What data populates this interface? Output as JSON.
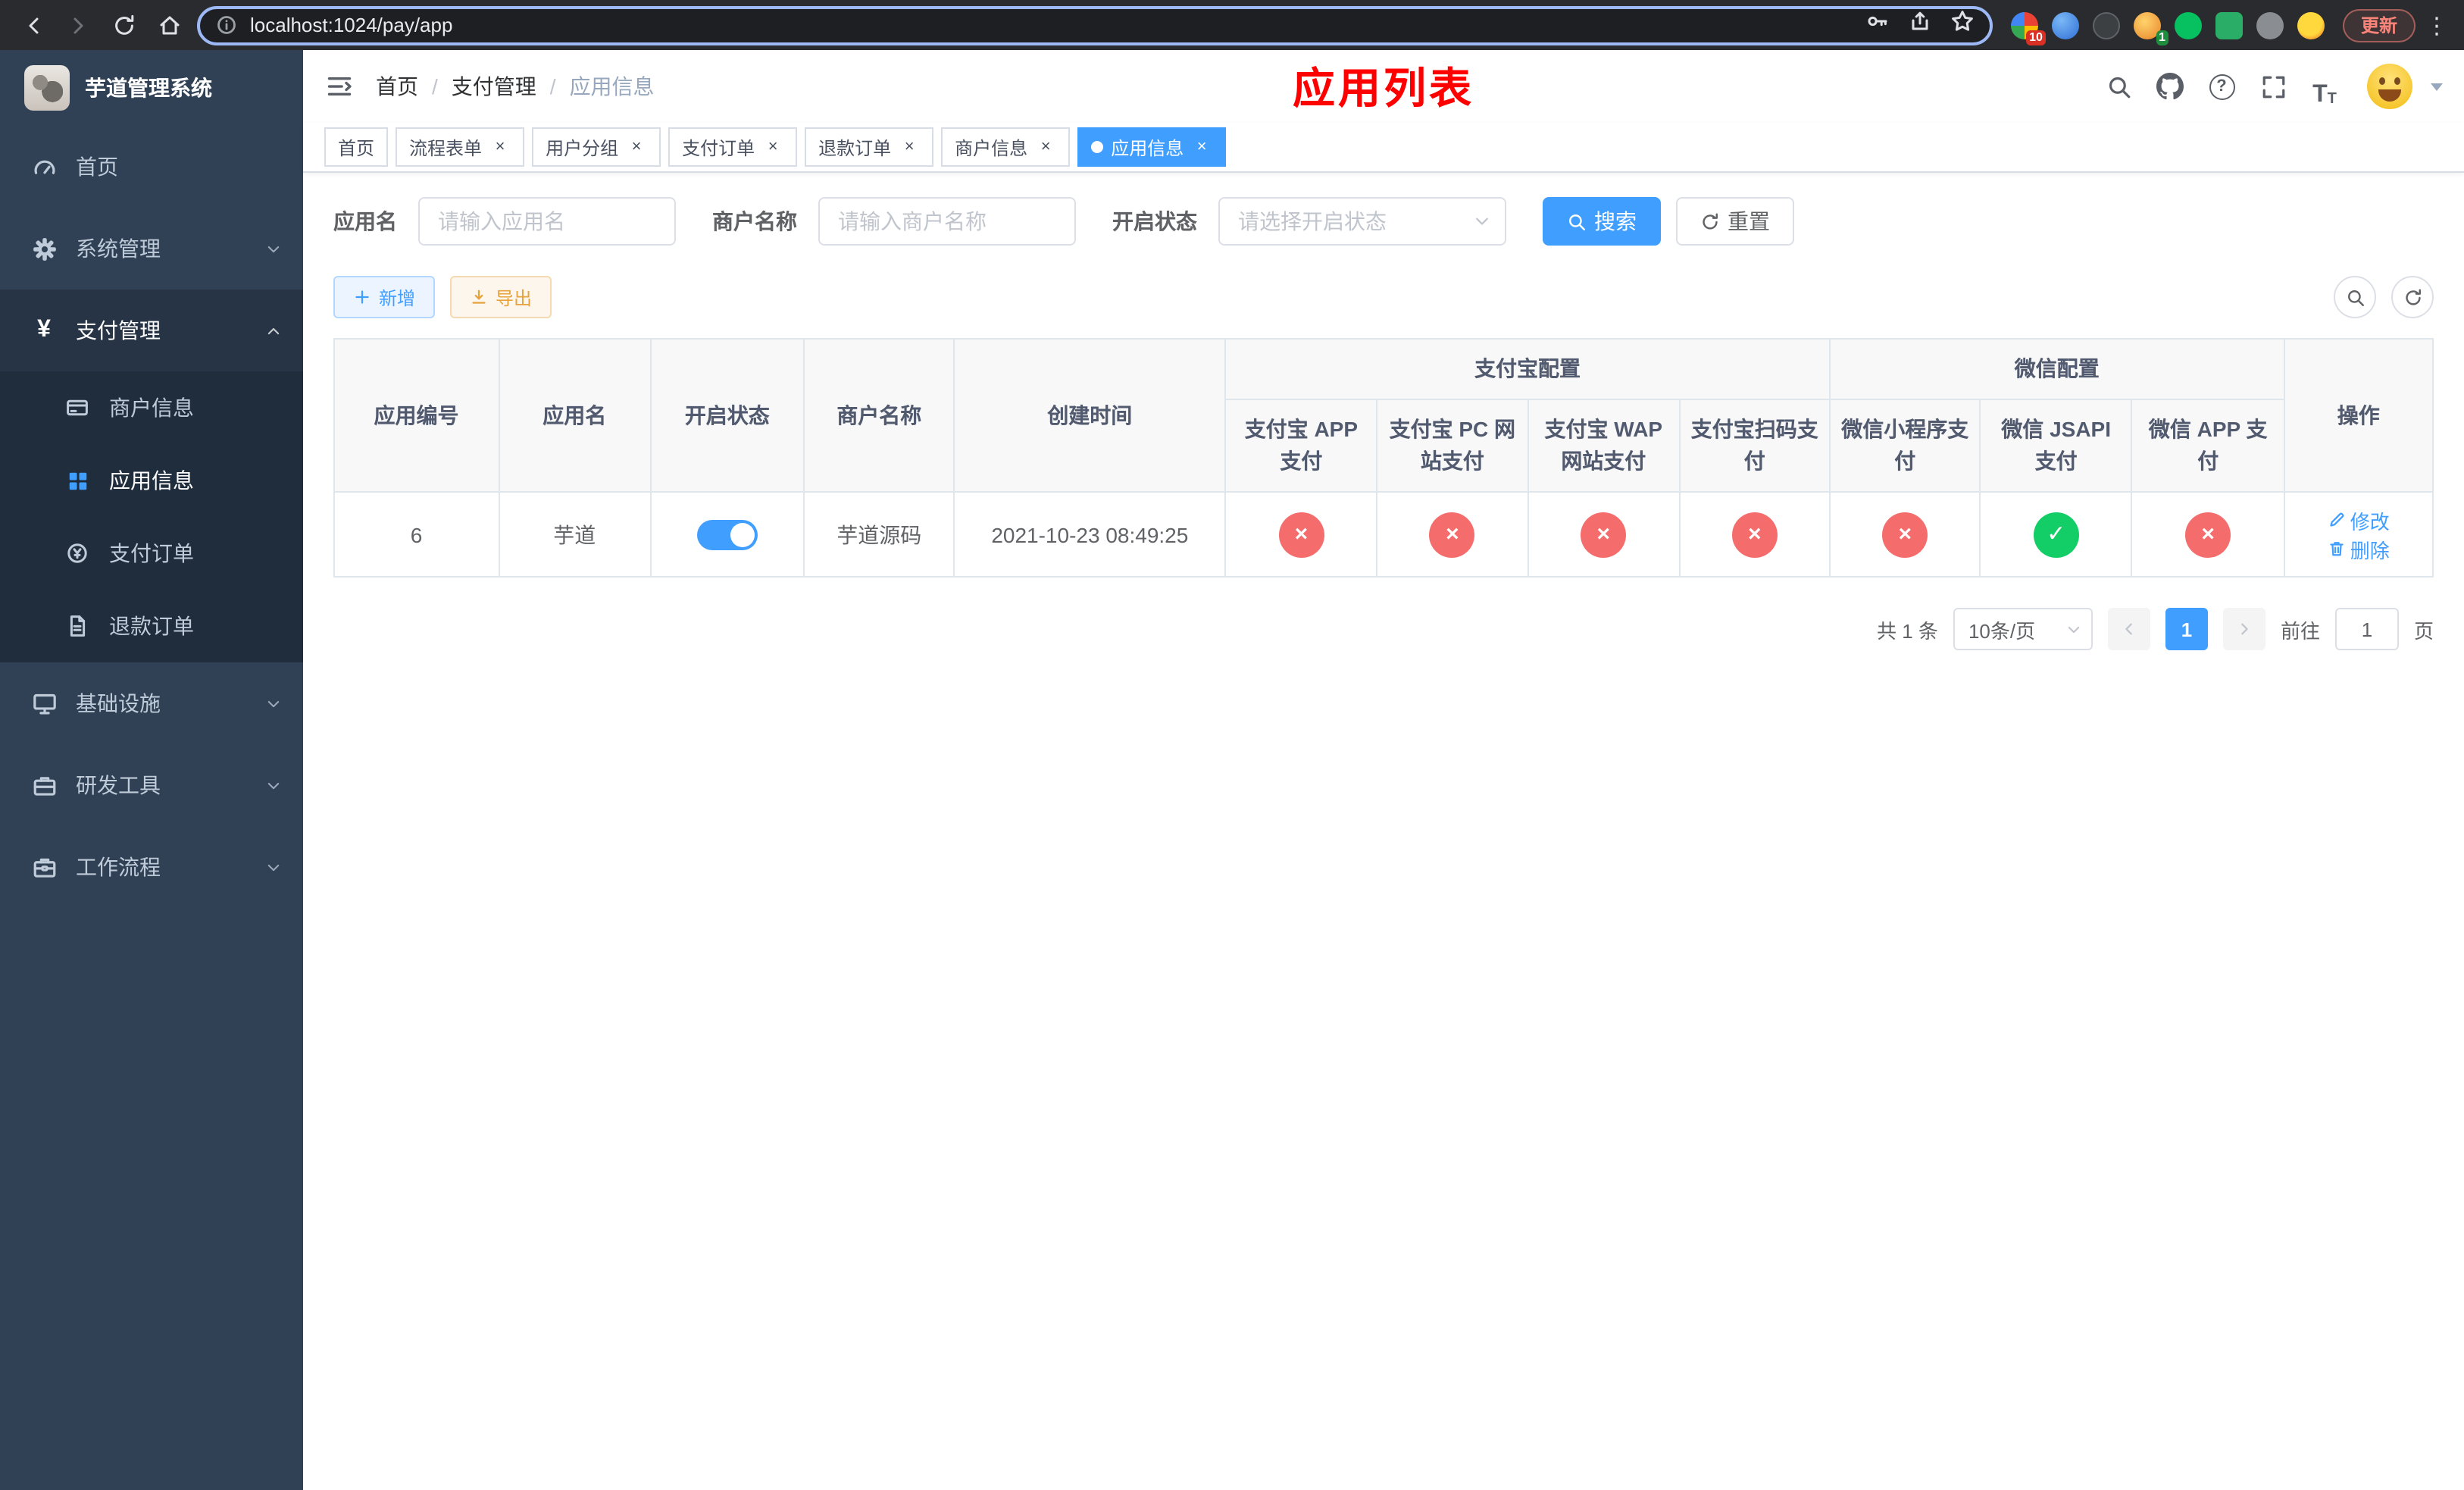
{
  "browser": {
    "url": "localhost:1024/pay/app",
    "update_label": "更新",
    "badges": [
      "10",
      "1"
    ]
  },
  "sidebar": {
    "app_title": "芋道管理系统",
    "items": [
      {
        "label": "首页"
      },
      {
        "label": "系统管理"
      },
      {
        "label": "支付管理"
      },
      {
        "label": "基础设施"
      },
      {
        "label": "研发工具"
      },
      {
        "label": "工作流程"
      }
    ],
    "payment_children": [
      {
        "label": "商户信息"
      },
      {
        "label": "应用信息"
      },
      {
        "label": "支付订单"
      },
      {
        "label": "退款订单"
      }
    ]
  },
  "header": {
    "breadcrumb": [
      "首页",
      "支付管理",
      "应用信息"
    ],
    "separator": "/",
    "page_title": "应用列表",
    "title_color": "#ff0000"
  },
  "tabs": [
    {
      "label": "首页",
      "closable": false
    },
    {
      "label": "流程表单",
      "closable": true
    },
    {
      "label": "用户分组",
      "closable": true
    },
    {
      "label": "支付订单",
      "closable": true
    },
    {
      "label": "退款订单",
      "closable": true
    },
    {
      "label": "商户信息",
      "closable": true
    },
    {
      "label": "应用信息",
      "closable": true,
      "active": true
    }
  ],
  "filter": {
    "app_name_label": "应用名",
    "app_name_placeholder": "请输入应用名",
    "merchant_label": "商户名称",
    "merchant_placeholder": "请输入商户名称",
    "status_label": "开启状态",
    "status_placeholder": "请选择开启状态",
    "search_label": "搜索",
    "reset_label": "重置"
  },
  "toolbar": {
    "add_label": "新增",
    "export_label": "导出"
  },
  "table": {
    "headers": {
      "app_id": "应用编号",
      "app_name": "应用名",
      "status": "开启状态",
      "merchant_name": "商户名称",
      "create_time": "创建时间",
      "alipay_group": "支付宝配置",
      "wechat_group": "微信配置",
      "alipay_app": "支付宝 APP 支付",
      "alipay_pc": "支付宝 PC 网站支付",
      "alipay_wap": "支付宝 WAP 网站支付",
      "alipay_scan": "支付宝扫码支付",
      "wechat_lite": "微信小程序支付",
      "wechat_jsapi": "微信 JSAPI 支付",
      "wechat_app": "微信 APP 支付",
      "actions": "操作"
    },
    "rows": [
      {
        "app_id": "6",
        "app_name": "芋道",
        "status_on": true,
        "merchant_name": "芋道源码",
        "create_time": "2021-10-23 08:49:25",
        "config": {
          "alipay_app": "disabled",
          "alipay_pc": "disabled",
          "alipay_wap": "disabled",
          "alipay_scan": "disabled",
          "wechat_lite": "disabled",
          "wechat_jsapi": "enabled",
          "wechat_app": "disabled"
        },
        "edit_label": "修改",
        "delete_label": "删除"
      }
    ]
  },
  "pagination": {
    "total_text": "共 1 条",
    "page_size_text": "10条/页",
    "current_page": "1",
    "goto_label": "前往",
    "goto_value": "1",
    "page_unit": "页"
  },
  "icons": {
    "close": "×",
    "check": "✓",
    "kebab": "⋮",
    "yen": "¥",
    "question": "?",
    "fontsize": "T"
  },
  "colors": {
    "accent": "#409eff",
    "danger": "#f56c6c",
    "success": "#13ce66",
    "sidebar_bg": "#304156",
    "title_red": "#ff0000"
  }
}
